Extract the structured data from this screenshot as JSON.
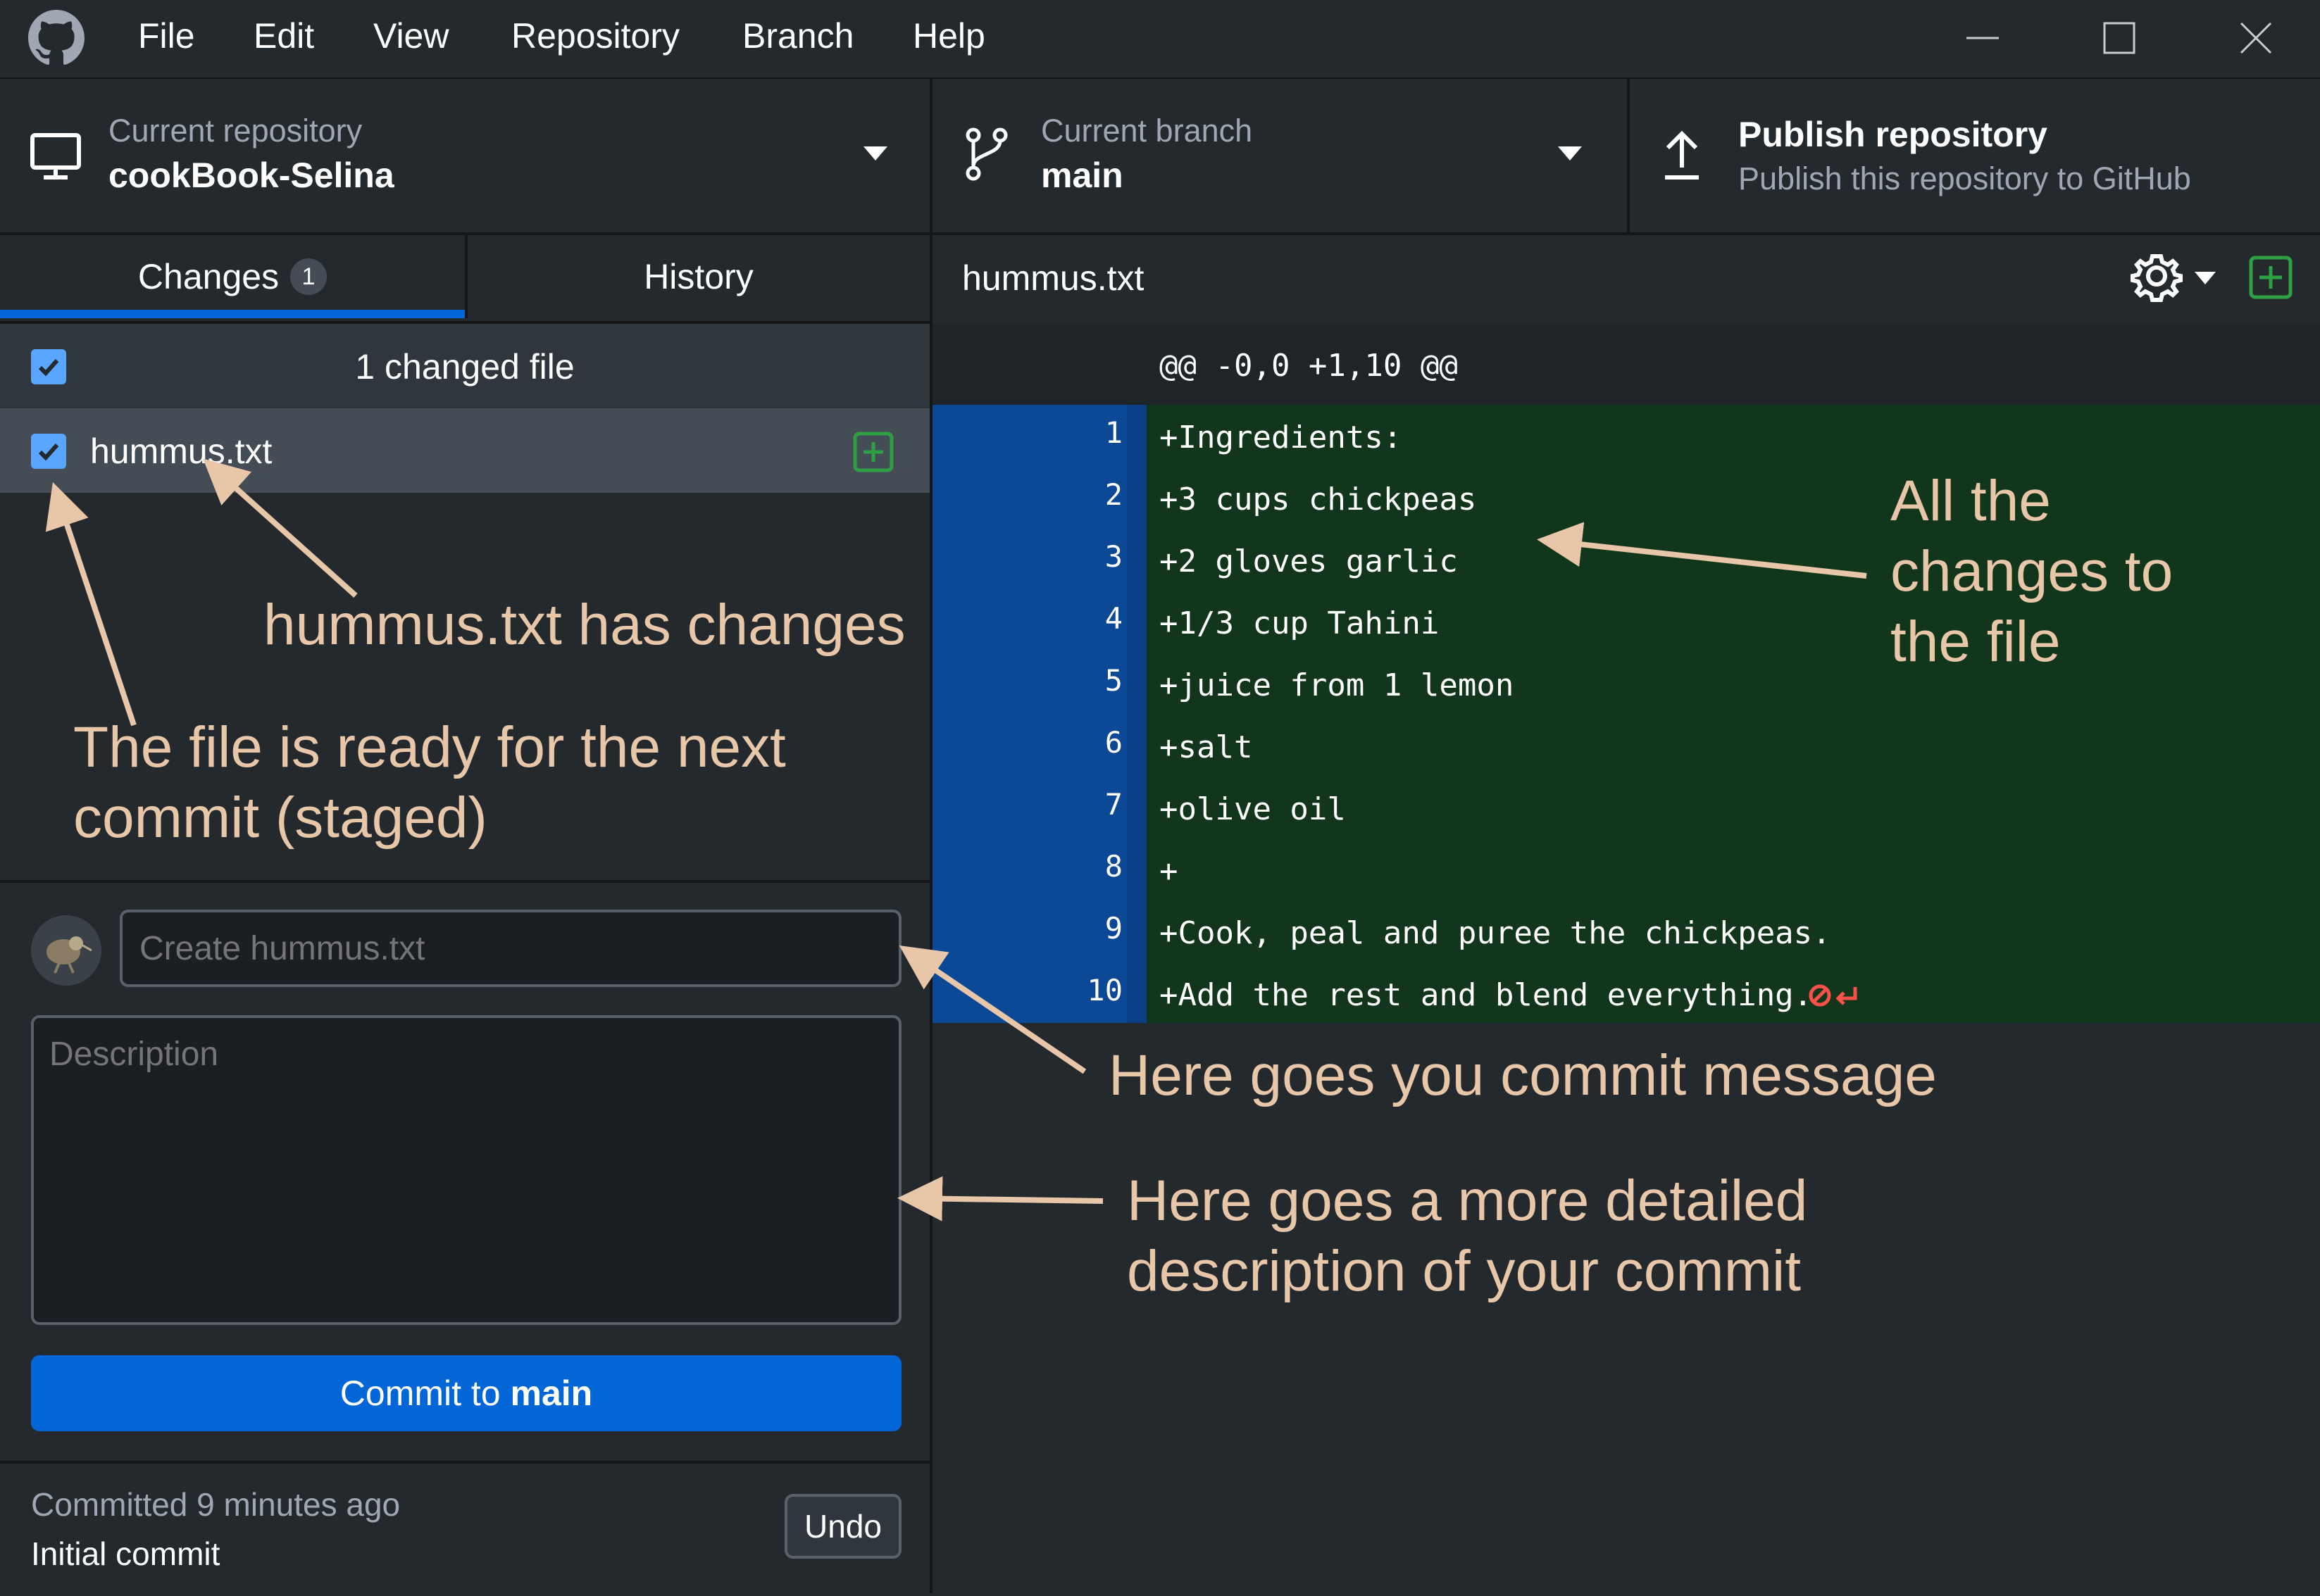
{
  "menu": {
    "items": [
      "File",
      "Edit",
      "View",
      "Repository",
      "Branch",
      "Help"
    ]
  },
  "toolbar": {
    "repository": {
      "label": "Current repository",
      "value": "cookBook-Selina"
    },
    "branch": {
      "label": "Current branch",
      "value": "main"
    },
    "publish": {
      "title": "Publish repository",
      "subtitle": "Publish this repository to GitHub"
    }
  },
  "tabs": {
    "changes": {
      "label": "Changes",
      "count": "1"
    },
    "history": {
      "label": "History"
    }
  },
  "changes_list": {
    "summary": "1 changed file",
    "files": [
      {
        "name": "hummus.txt",
        "status": "added"
      }
    ]
  },
  "commit": {
    "summary_placeholder": "Create hummus.txt",
    "description_placeholder": "Description",
    "button_prefix": "Commit to",
    "button_branch": "main"
  },
  "last_commit": {
    "time": "Committed 9 minutes ago",
    "message": "Initial commit",
    "undo_label": "Undo"
  },
  "diff": {
    "filename": "hummus.txt",
    "hunk_header": "@@ -0,0 +1,10 @@",
    "lines": [
      {
        "number": "1",
        "text": "+Ingredients:"
      },
      {
        "number": "2",
        "text": "+3 cups chickpeas"
      },
      {
        "number": "3",
        "text": "+2 gloves garlic"
      },
      {
        "number": "4",
        "text": "+1/3 cup Tahini"
      },
      {
        "number": "5",
        "text": "+juice from 1 lemon"
      },
      {
        "number": "6",
        "text": "+salt"
      },
      {
        "number": "7",
        "text": "+olive oil"
      },
      {
        "number": "8",
        "text": "+"
      },
      {
        "number": "9",
        "text": "+Cook, peal and puree the chickpeas."
      },
      {
        "number": "10",
        "text": "+Add the rest and blend everything."
      }
    ]
  },
  "annotations": {
    "has_changes": "hummus.txt has changes",
    "staged_line1": "The file is ready for the next",
    "staged_line2": "commit (staged)",
    "all_changes_line1": "All the",
    "all_changes_line2": "changes to",
    "all_changes_line3": "the file",
    "commit_message": "Here goes you commit message",
    "description_line1": "Here goes a more detailed",
    "description_line2": "description of your commit"
  },
  "colors": {
    "background": "#24292e",
    "accent_blue": "#0366d6",
    "added_line_bg": "#12361b",
    "gutter_blue": "#0b4896",
    "annotation": "#e8c6a8",
    "added_icon": "#2ea043"
  },
  "icons": [
    "github-logo-icon",
    "computer-icon",
    "branch-icon",
    "upload-icon",
    "gear-icon",
    "add-file-icon",
    "no-newline-icon"
  ]
}
